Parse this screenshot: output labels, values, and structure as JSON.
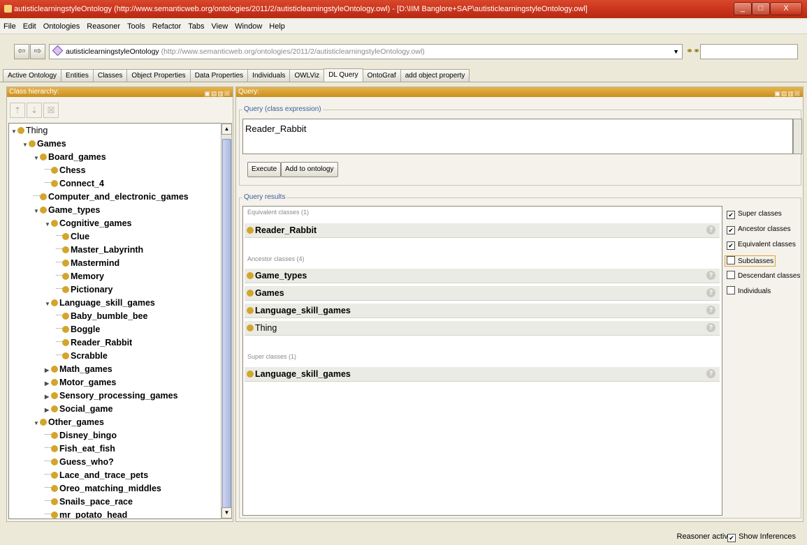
{
  "window": {
    "title": "autisticlearningstyleOntology (http://www.semanticweb.org/ontologies/2011/2/autisticlearningstyleOntology.owl) - [D:\\IIM Banglore+SAP\\autisticlearningstyleOntology.owl]",
    "minimize": "_",
    "restore": "□",
    "close": "X"
  },
  "menu": [
    "File",
    "Edit",
    "Ontologies",
    "Reasoner",
    "Tools",
    "Refactor",
    "Tabs",
    "View",
    "Window",
    "Help"
  ],
  "address": {
    "ontology_name": "autisticlearningstyleOntology",
    "ontology_iri": "(http://www.semanticweb.org/ontologies/2011/2/autisticlearningstyleOntology.owl)",
    "search_value": ""
  },
  "tabs": [
    "Active Ontology",
    "Entities",
    "Classes",
    "Object Properties",
    "Data Properties",
    "Individuals",
    "OWLViz",
    "DL Query",
    "OntoGraf",
    "add object property"
  ],
  "active_tab": "DL Query",
  "class_hierarchy": {
    "title": "Class hierarchy:",
    "rows": [
      {
        "label": "Thing",
        "depth": 0,
        "toggle": "open",
        "bold": false
      },
      {
        "label": "Games",
        "depth": 1,
        "toggle": "open",
        "bold": true
      },
      {
        "label": "Board_games",
        "depth": 2,
        "toggle": "open",
        "bold": true
      },
      {
        "label": "Chess",
        "depth": 3,
        "toggle": "leaf",
        "bold": true
      },
      {
        "label": "Connect_4",
        "depth": 3,
        "toggle": "leaf",
        "bold": true
      },
      {
        "label": "Computer_and_electronic_games",
        "depth": 2,
        "toggle": "leaf",
        "bold": true
      },
      {
        "label": "Game_types",
        "depth": 2,
        "toggle": "open",
        "bold": true
      },
      {
        "label": "Cognitive_games",
        "depth": 3,
        "toggle": "open",
        "bold": true
      },
      {
        "label": "Clue",
        "depth": 4,
        "toggle": "leaf",
        "bold": true
      },
      {
        "label": "Master_Labyrinth",
        "depth": 4,
        "toggle": "leaf",
        "bold": true
      },
      {
        "label": "Mastermind",
        "depth": 4,
        "toggle": "leaf",
        "bold": true
      },
      {
        "label": "Memory",
        "depth": 4,
        "toggle": "leaf",
        "bold": true
      },
      {
        "label": "Pictionary",
        "depth": 4,
        "toggle": "leaf",
        "bold": true
      },
      {
        "label": "Language_skill_games",
        "depth": 3,
        "toggle": "open",
        "bold": true
      },
      {
        "label": "Baby_bumble_bee",
        "depth": 4,
        "toggle": "leaf",
        "bold": true
      },
      {
        "label": "Boggle",
        "depth": 4,
        "toggle": "leaf",
        "bold": true
      },
      {
        "label": "Reader_Rabbit",
        "depth": 4,
        "toggle": "leaf",
        "bold": true
      },
      {
        "label": "Scrabble",
        "depth": 4,
        "toggle": "leaf",
        "bold": true
      },
      {
        "label": "Math_games",
        "depth": 3,
        "toggle": "closed",
        "bold": true
      },
      {
        "label": "Motor_games",
        "depth": 3,
        "toggle": "closed",
        "bold": true
      },
      {
        "label": "Sensory_processing_games",
        "depth": 3,
        "toggle": "closed",
        "bold": true
      },
      {
        "label": "Social_game",
        "depth": 3,
        "toggle": "closed",
        "bold": true
      },
      {
        "label": "Other_games",
        "depth": 2,
        "toggle": "open",
        "bold": true
      },
      {
        "label": "Disney_bingo",
        "depth": 3,
        "toggle": "leaf",
        "bold": true
      },
      {
        "label": "Fish_eat_fish",
        "depth": 3,
        "toggle": "leaf",
        "bold": true
      },
      {
        "label": "Guess_who?",
        "depth": 3,
        "toggle": "leaf",
        "bold": true
      },
      {
        "label": "Lace_and_trace_pets",
        "depth": 3,
        "toggle": "leaf",
        "bold": true
      },
      {
        "label": "Oreo_matching_middles",
        "depth": 3,
        "toggle": "leaf",
        "bold": true
      },
      {
        "label": "Snails_pace_race",
        "depth": 3,
        "toggle": "leaf",
        "bold": true
      },
      {
        "label": "mr_potato_head",
        "depth": 3,
        "toggle": "leaf",
        "bold": true
      }
    ]
  },
  "query": {
    "panel_title": "Query:",
    "expression_label": "Query (class expression)",
    "expression_value": "Reader_Rabbit",
    "execute_label": "Execute",
    "add_label": "Add to ontology",
    "results_label": "Query results",
    "sections": [
      {
        "title": "Equivalent classes (1)",
        "items": [
          {
            "label": "Reader_Rabbit",
            "bold": true
          }
        ]
      },
      {
        "title": "Ancestor classes (4)",
        "items": [
          {
            "label": "Game_types",
            "bold": true
          },
          {
            "label": "Games",
            "bold": true
          },
          {
            "label": "Language_skill_games",
            "bold": true
          },
          {
            "label": "Thing",
            "bold": false
          }
        ]
      },
      {
        "title": "Super classes (1)",
        "items": [
          {
            "label": "Language_skill_games",
            "bold": true
          }
        ]
      }
    ],
    "options": [
      {
        "label": "Super classes",
        "checked": true
      },
      {
        "label": "Ancestor classes",
        "checked": true
      },
      {
        "label": "Equivalent classes",
        "checked": true
      },
      {
        "label": "Subclasses",
        "checked": false
      },
      {
        "label": "Descendant classes",
        "checked": false
      },
      {
        "label": "Individuals",
        "checked": false
      }
    ]
  },
  "status": {
    "reasoner": "Reasoner active",
    "show_inferences": "Show Inferences"
  },
  "colors": {
    "class_dot": "#d3a52a",
    "panel_header": "#d9a236",
    "titlebar": "#c8321a"
  }
}
